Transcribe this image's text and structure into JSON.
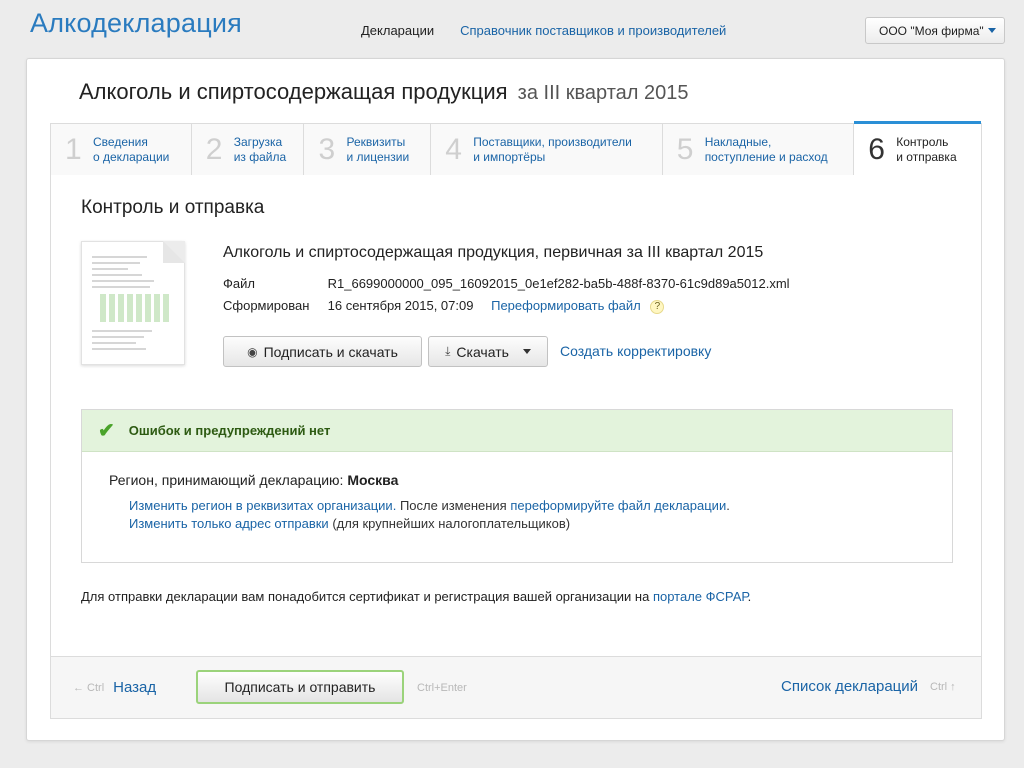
{
  "header": {
    "logo": "Алкодекларация",
    "nav": [
      "Декларации",
      "Справочник поставщиков и производителей"
    ],
    "org": "ООО \"Моя фирма\""
  },
  "title": {
    "main": "Алкоголь и спиртосодержащая продукция",
    "period": "за III квартал 2015"
  },
  "steps": [
    {
      "num": "1",
      "line1": "Сведения",
      "line2": "о декларации"
    },
    {
      "num": "2",
      "line1": "Загрузка",
      "line2": "из файла"
    },
    {
      "num": "3",
      "line1": "Реквизиты",
      "line2": "и лицензии"
    },
    {
      "num": "4",
      "line1": "Поставщики, производители",
      "line2": "и импортёры"
    },
    {
      "num": "5",
      "line1": "Накладные,",
      "line2": "поступление и расход"
    },
    {
      "num": "6",
      "line1": "Контроль",
      "line2": "и отправка"
    }
  ],
  "section_title": "Контроль и отправка",
  "document": {
    "title": "Алкоголь и спиртосодержащая продукция, первичная за III квартал 2015",
    "file_label": "Файл",
    "file_value": "R1_6699000000_095_16092015_0e1ef282-ba5b-488f-8370-61c9d89a5012.xml",
    "formed_label": "Сформирован",
    "formed_value": "16 сентября 2015, 07:09",
    "reformat_link": "Переформировать файл",
    "help": "?"
  },
  "buttons": {
    "sign_download": "Подписать и скачать",
    "download": "Скачать",
    "create_correction": "Создать корректировку"
  },
  "status": {
    "ok_text": "Ошибок и предупреждений нет",
    "region_label": "Регион, принимающий декларацию:",
    "region_value": "Москва",
    "change_region_link": "Изменить регион в реквизитах организации.",
    "after_change": "После изменения",
    "reformat_decl_link": "переформируйте файл декларации",
    "dot": ".",
    "change_address_link": "Изменить только адрес отправки",
    "address_note": "(для крупнейших налогоплательщиков)"
  },
  "footnote": {
    "text": "Для отправки декларации вам понадобится сертификат и регистрация вашей организации на",
    "link": "портале ФСРАР",
    "dot": "."
  },
  "bottom": {
    "back_hint": "← Ctrl",
    "back": "Назад",
    "send": "Подписать и отправить",
    "send_hint": "Ctrl+Enter",
    "list": "Список деклараций",
    "list_hint": "Ctrl ↑"
  }
}
